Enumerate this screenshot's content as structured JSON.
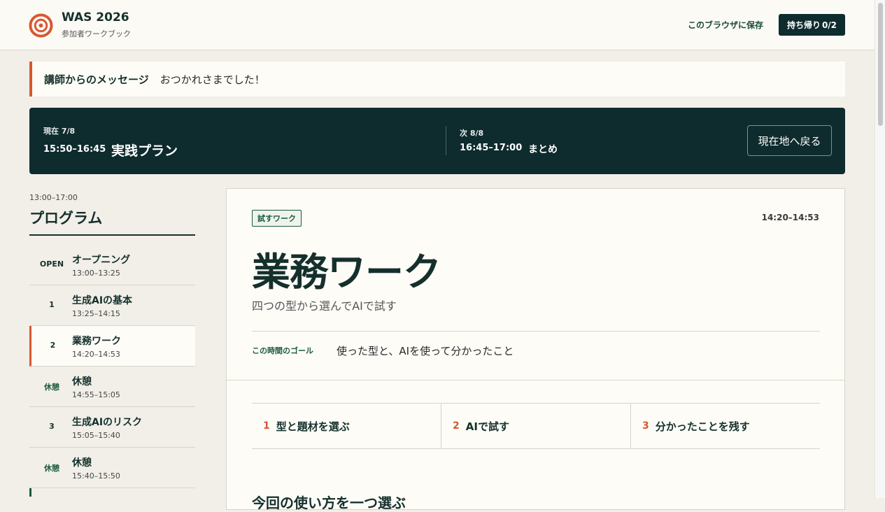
{
  "header": {
    "brand_title": "WAS 2026",
    "brand_subtitle": "参加者ワークブック",
    "save_link": "このブラウザに保存",
    "takeaway_label": "持ち帰り",
    "takeaway_count": "0/2"
  },
  "message": {
    "label": "講師からのメッセージ",
    "text": "おつかれさまでした！"
  },
  "now": {
    "label": "現在 7/8",
    "time": "15:50–16:45",
    "title": "実践プラン",
    "next_label": "次 8/8",
    "next_time": "16:45–17:00",
    "next_title": "まとめ",
    "return_button": "現在地へ戻る"
  },
  "program": {
    "range": "13:00–17:00",
    "title": "プログラム",
    "items": [
      {
        "badge": "OPEN",
        "name": "オープニング",
        "time": "13:00–13:25"
      },
      {
        "badge": "1",
        "name": "生成AIの基本",
        "time": "13:25–14:15"
      },
      {
        "badge": "2",
        "name": "業務ワーク",
        "time": "14:20–14:53"
      },
      {
        "badge": "休憩",
        "name": "休憩",
        "time": "14:55–15:05"
      },
      {
        "badge": "3",
        "name": "生成AIのリスク",
        "time": "15:05–15:40"
      },
      {
        "badge": "休憩",
        "name": "休憩",
        "time": "15:40–15:50"
      }
    ]
  },
  "card": {
    "tag": "試すワーク",
    "time": "14:20–14:53",
    "title": "業務ワーク",
    "subtitle": "四つの型から選んでAIで試す",
    "goal_label": "この時間のゴール",
    "goal_text": "使った型と、AIを使って分かったこと",
    "steps": [
      {
        "num": "1",
        "label": "型と題材を選ぶ"
      },
      {
        "num": "2",
        "label": "AIで試す"
      },
      {
        "num": "3",
        "label": "分かったことを残す"
      }
    ],
    "next_heading": "今回の使い方を一つ選ぶ"
  },
  "colors": {
    "accent": "#d9572f",
    "dark": "#0e2b2e",
    "green": "#1a5a3c",
    "background": "#f1efe8"
  }
}
